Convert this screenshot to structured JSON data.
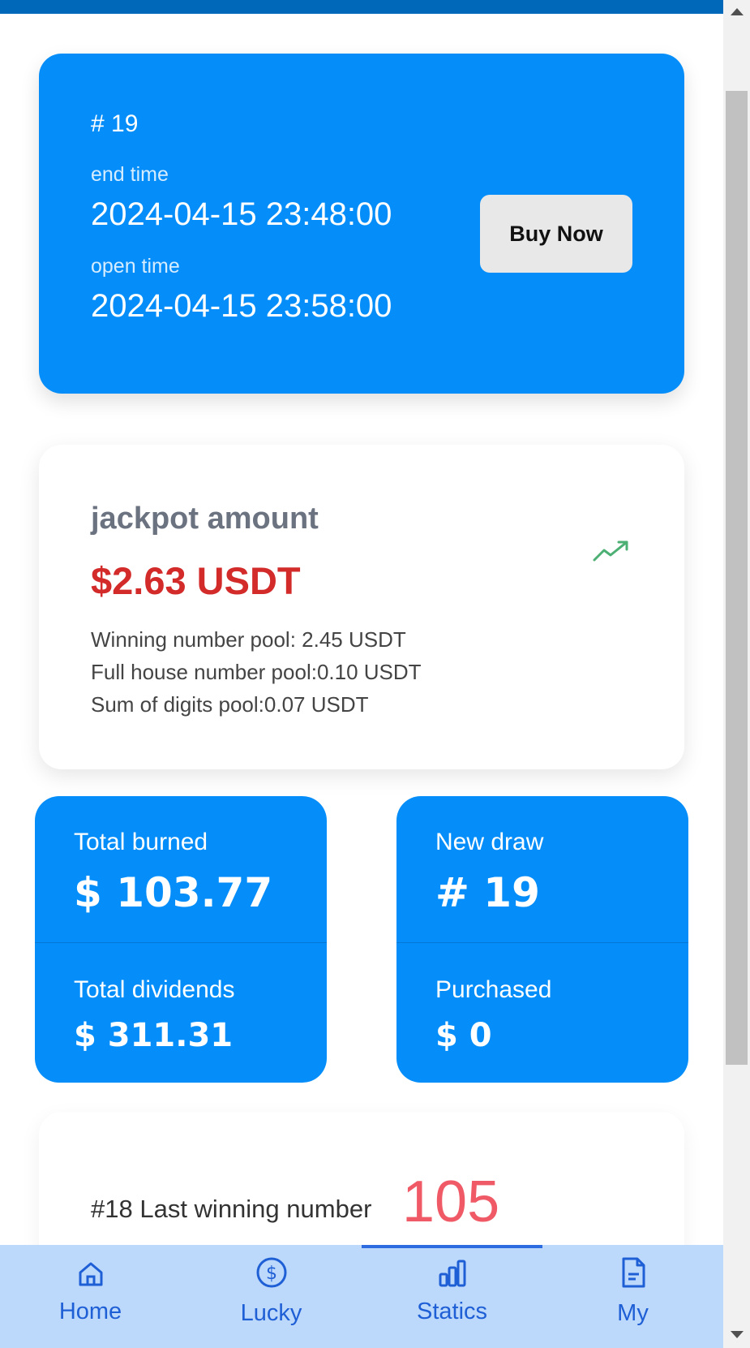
{
  "draw": {
    "number": "# 19",
    "end_label": "end time",
    "end_time": "2024-04-15 23:48:00",
    "open_label": "open time",
    "open_time": "2024-04-15 23:58:00",
    "buy_label": "Buy Now"
  },
  "jackpot": {
    "title": "jackpot amount",
    "amount": "$2.63 USDT",
    "pools": [
      "Winning number pool: 2.45 USDT",
      "Full house number pool:0.10 USDT",
      "Sum of digits pool:0.07 USDT"
    ],
    "trend_icon": "trending-up-icon"
  },
  "stats": {
    "total_burned_label": "Total burned",
    "total_burned_value": "$ 103.77",
    "total_dividends_label": "Total dividends",
    "total_dividends_value": "$ 311.31",
    "new_draw_label": "New draw",
    "new_draw_value": "# 19",
    "purchased_label": "Purchased",
    "purchased_value": "$ 0"
  },
  "last_win": {
    "label": "#18 Last winning number",
    "number": "105"
  },
  "nav": {
    "items": [
      {
        "label": "Home",
        "icon": "home-icon"
      },
      {
        "label": "Lucky",
        "icon": "dollar-circle-icon"
      },
      {
        "label": "Statics",
        "icon": "bar-chart-icon"
      },
      {
        "label": "My",
        "icon": "document-icon"
      }
    ],
    "active": "Statics"
  },
  "colors": {
    "card_blue": "#058ef9",
    "nav_background": "#bcd9fb",
    "nav_text": "#1f5fd6",
    "jackpot_red": "#d32a2a",
    "last_number_red": "#f05a66",
    "trend_green": "#4caf73"
  }
}
